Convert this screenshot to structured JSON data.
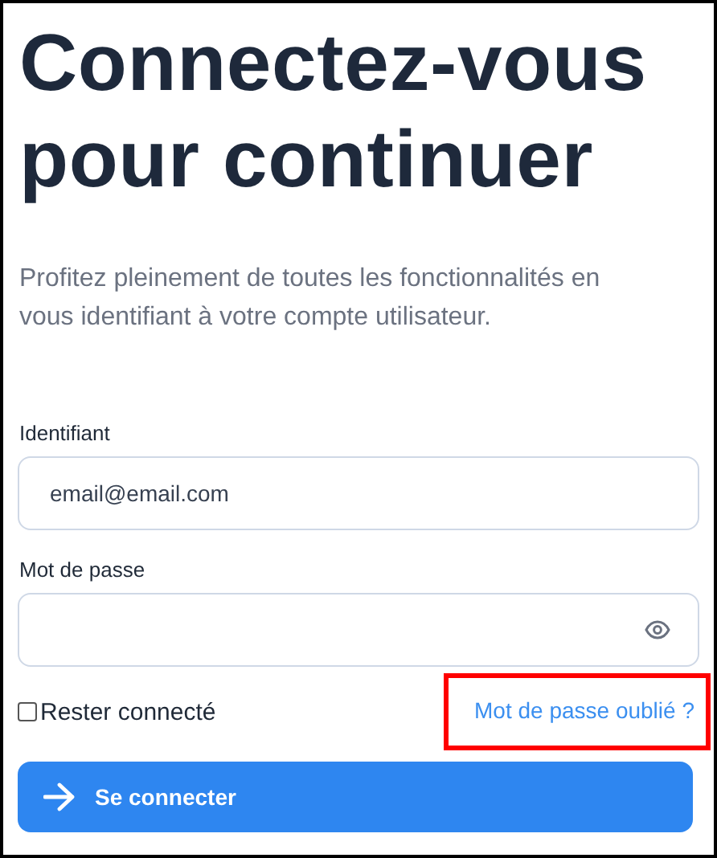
{
  "title": "Connectez-vous pour continuer",
  "subtitle": "Profitez pleinement de toutes les fonctionnalités en vous identifiant à votre compte utilisateur.",
  "fields": [
    {
      "kind": "text",
      "label": "Identifiant",
      "value": "email@email.com"
    },
    {
      "kind": "password",
      "label": "Mot de passe"
    }
  ],
  "remember": {
    "label": "Rester connecté",
    "checked": false
  },
  "forgot_link": {
    "label": "Mot de passe oublié ?",
    "highlighted": true
  },
  "submit_button": {
    "label": "Se connecter"
  }
}
